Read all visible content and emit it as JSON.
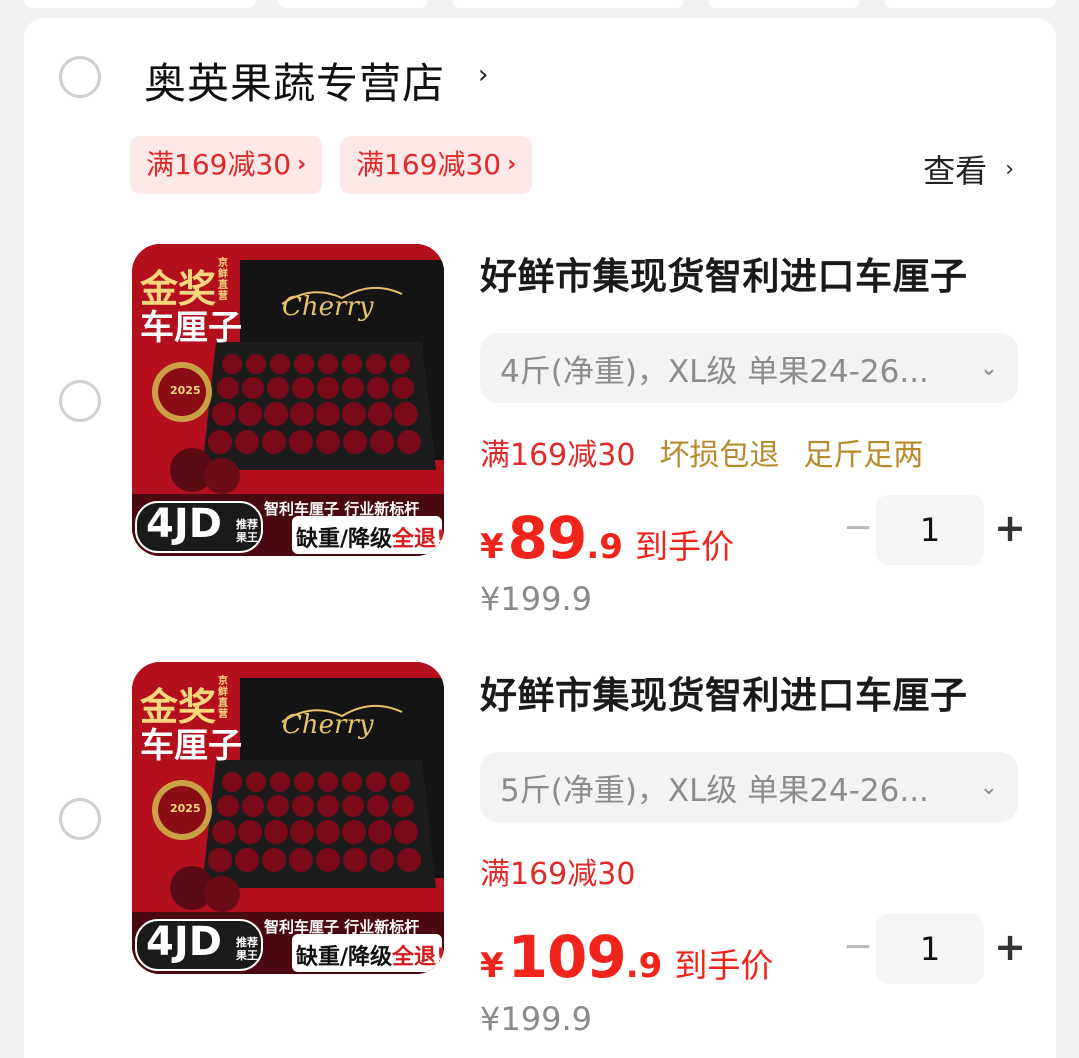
{
  "store": {
    "name": "奥英果蔬专营店",
    "coupons": [
      "满169减30",
      "满169减30"
    ],
    "view_label": "查看"
  },
  "thumbnail": {
    "award": "金奖",
    "product_word": "车厘子",
    "corner_tag": "京鲜直营",
    "script_word": "Cherry",
    "seal_year": "2025",
    "tagline": "智利车厘子 行业新标杆",
    "grade": "4JD",
    "grade_note": "推荐果王",
    "guarantee_plain": "缺重/降级",
    "guarantee_accent": "全退!"
  },
  "products": [
    {
      "title": "好鲜市集现货智利进口车厘子",
      "spec": "4斤(净重)，XL级 单果24-26...",
      "tags": [
        {
          "text": "满169减30",
          "style": "red"
        },
        {
          "text": "坏损包退",
          "style": "gold"
        },
        {
          "text": "足斤足两",
          "style": "gold"
        }
      ],
      "price_currency": "¥",
      "price_int": "89",
      "price_dec": ".9",
      "price_suffix": "到手价",
      "original_price": "¥199.9",
      "quantity": "1"
    },
    {
      "title": "好鲜市集现货智利进口车厘子",
      "spec": "5斤(净重)，XL级 单果24-26...",
      "tags": [
        {
          "text": "满169减30",
          "style": "red"
        }
      ],
      "price_currency": "¥",
      "price_int": "109",
      "price_dec": ".9",
      "price_suffix": "到手价",
      "original_price": "¥199.9",
      "quantity": "1"
    }
  ],
  "stepper": {
    "minus": "−",
    "plus": "+"
  },
  "colors": {
    "price_red": "#f0241b",
    "coupon_bg": "#fde8e8",
    "tag_gold": "#b88a2c",
    "thumb_red": "#b40f1c"
  }
}
